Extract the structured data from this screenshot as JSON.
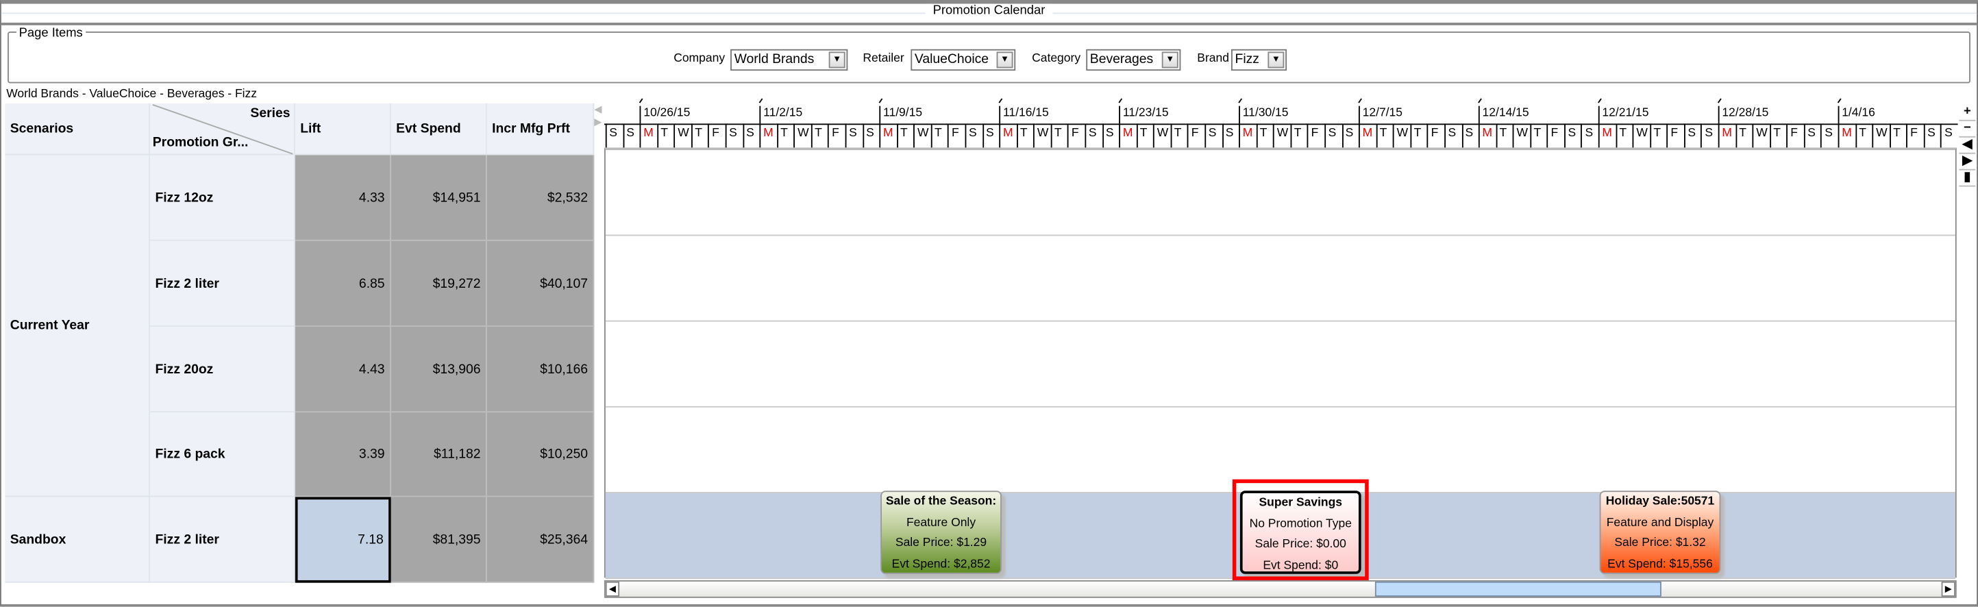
{
  "window": {
    "title": "Promotion Calendar"
  },
  "page_items": {
    "legend": "Page Items",
    "filters": [
      {
        "label": "Company",
        "value": "World Brands"
      },
      {
        "label": "Retailer",
        "value": "ValueChoice"
      },
      {
        "label": "Category",
        "value": "Beverages"
      },
      {
        "label": "Brand",
        "value": "Fizz"
      }
    ]
  },
  "breadcrumb": "World Brands - ValueChoice - Beverages - Fizz",
  "grid": {
    "headers": {
      "scenarios": "Scenarios",
      "series": "Series",
      "promotion_group": "Promotion Gr...",
      "columns": [
        "Lift",
        "Evt Spend",
        "Incr Mfg Prft"
      ]
    },
    "scenarios": [
      {
        "name": "Current Year"
      },
      {
        "name": "Sandbox"
      }
    ],
    "rows": [
      {
        "product": "Fizz 12oz",
        "values": [
          "4.33",
          "$14,951",
          "$2,532"
        ]
      },
      {
        "product": "Fizz 2 liter",
        "values": [
          "6.85",
          "$19,272",
          "$40,107"
        ]
      },
      {
        "product": "Fizz 20oz",
        "values": [
          "4.43",
          "$13,906",
          "$10,166"
        ]
      },
      {
        "product": "Fizz 6 pack",
        "values": [
          "3.39",
          "$11,182",
          "$10,250"
        ]
      },
      {
        "product": "Fizz 2 liter",
        "values": [
          "7.18",
          "$81,395",
          "$25,364"
        ]
      }
    ]
  },
  "calendar": {
    "lead_days": [
      "S",
      "S"
    ],
    "week_days": [
      "M",
      "T",
      "W",
      "T",
      "F",
      "S",
      "S"
    ],
    "weeks": [
      "10/26/15",
      "11/2/15",
      "11/9/15",
      "11/16/15",
      "11/23/15",
      "11/30/15",
      "12/7/15",
      "12/14/15",
      "12/21/15",
      "12/28/15",
      "1/4/16"
    ],
    "nav": [
      "+",
      "−",
      "◀",
      "▶",
      "▮"
    ],
    "cards": [
      {
        "title": "Sale of the Season:",
        "type": "Feature Only",
        "price": "Sale Price:  $1.29",
        "spend": "Evt Spend:  $2,852"
      },
      {
        "title": "Super Savings",
        "type": "No Promotion Type",
        "price": "Sale Price:  $0.00",
        "spend": "Evt Spend:  $0"
      },
      {
        "title": "Holiday Sale:50571",
        "type": "Feature and Display",
        "price": "Sale Price:  $1.32",
        "spend": "Evt Spend:  $15,556"
      }
    ]
  },
  "colors": {
    "monday": "#e00000",
    "sandbox_row": "#c2cfe2",
    "highlight": "#ff0000"
  }
}
